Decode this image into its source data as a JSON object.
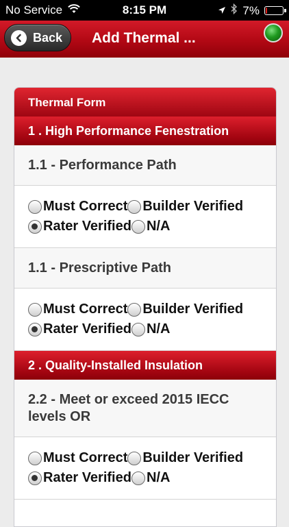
{
  "status_bar": {
    "carrier": "No Service",
    "time": "8:15 PM",
    "battery_percent": "7%",
    "battery_level": 0.07
  },
  "nav": {
    "back_label": "Back",
    "title": "Add Thermal ...",
    "status_indicator_color": "#1f9a1f"
  },
  "form": {
    "title": "Thermal Form",
    "sections": [
      {
        "heading": "1 . High Performance Fenestration",
        "questions": [
          {
            "label": "1.1 - Performance Path",
            "selected": "Rater Verified"
          },
          {
            "label": "1.1 - Prescriptive Path",
            "selected": "Rater Verified"
          }
        ]
      },
      {
        "heading": "2 . Quality-Installed Insulation",
        "questions": [
          {
            "label": "2.2 - Meet or exceed 2015 IECC levels OR",
            "selected": "Rater Verified"
          }
        ]
      }
    ],
    "options": [
      "Must Correct",
      "Builder Verified",
      "Rater Verified",
      "N/A"
    ]
  },
  "colors": {
    "brand_red": "#b20814",
    "status_green": "#1f9a1f"
  }
}
